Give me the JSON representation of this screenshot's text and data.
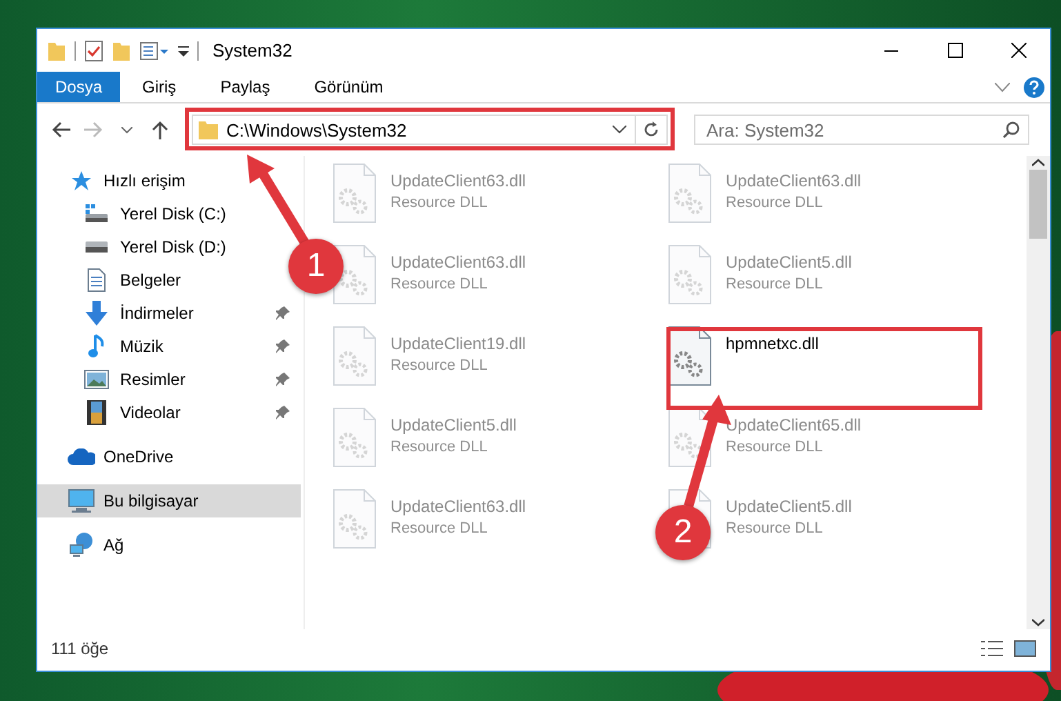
{
  "window": {
    "title": "System32"
  },
  "ribbon_tabs": [
    {
      "label": "Dosya",
      "selected": true
    },
    {
      "label": "Giriş",
      "selected": false
    },
    {
      "label": "Paylaş",
      "selected": false
    },
    {
      "label": "Görünüm",
      "selected": false
    }
  ],
  "address_bar": {
    "value": "C:\\Windows\\System32"
  },
  "search": {
    "placeholder": "Ara: System32"
  },
  "sidebar": {
    "items": [
      {
        "label": "Hızlı erişim",
        "kind": "star",
        "selected": false,
        "children": [
          {
            "label": "Yerel Disk (C:)",
            "kind": "drive-windows",
            "selected": false,
            "pinned": false
          },
          {
            "label": "Yerel Disk (D:)",
            "kind": "drive",
            "selected": false,
            "pinned": false
          },
          {
            "label": "Belgeler",
            "kind": "document",
            "selected": false,
            "pinned": false
          },
          {
            "label": "İndirmeler",
            "kind": "download",
            "selected": false,
            "pinned": true
          },
          {
            "label": "Müzik",
            "kind": "music",
            "selected": false,
            "pinned": true
          },
          {
            "label": "Resimler",
            "kind": "picture",
            "selected": false,
            "pinned": true
          },
          {
            "label": "Videolar",
            "kind": "video",
            "selected": false,
            "pinned": true
          }
        ]
      },
      {
        "label": "OneDrive",
        "kind": "cloud",
        "selected": false
      },
      {
        "label": "Bu bilgisayar",
        "kind": "computer",
        "selected": true
      },
      {
        "label": "Ağ",
        "kind": "network",
        "selected": false
      }
    ]
  },
  "files": [
    {
      "name": "UpdateClient63.dll",
      "type": "Resource DLL",
      "faded": true
    },
    {
      "name": "UpdateClient63.dll",
      "type": "Resource DLL",
      "faded": true
    },
    {
      "name": "UpdateClient63.dll",
      "type": "Resource DLL",
      "faded": true
    },
    {
      "name": "UpdateClient5.dll",
      "type": "Resource DLL",
      "faded": true
    },
    {
      "name": "UpdateClient19.dll",
      "type": "Resource DLL",
      "faded": true
    },
    {
      "name": "hpmnetxc.dll",
      "faded": false
    },
    {
      "name": "UpdateClient5.dll",
      "type": "Resource DLL",
      "faded": true
    },
    {
      "name": "UpdateClient65.dll",
      "type": "Resource DLL",
      "faded": true
    },
    {
      "name": "UpdateClient63.dll",
      "type": "Resource DLL",
      "faded": true
    },
    {
      "name": "UpdateClient5.dll",
      "type": "Resource DLL",
      "faded": true
    }
  ],
  "status_bar": {
    "item_count": "111 öğe"
  },
  "annotations": [
    {
      "number": "1"
    },
    {
      "number": "2"
    }
  ]
}
